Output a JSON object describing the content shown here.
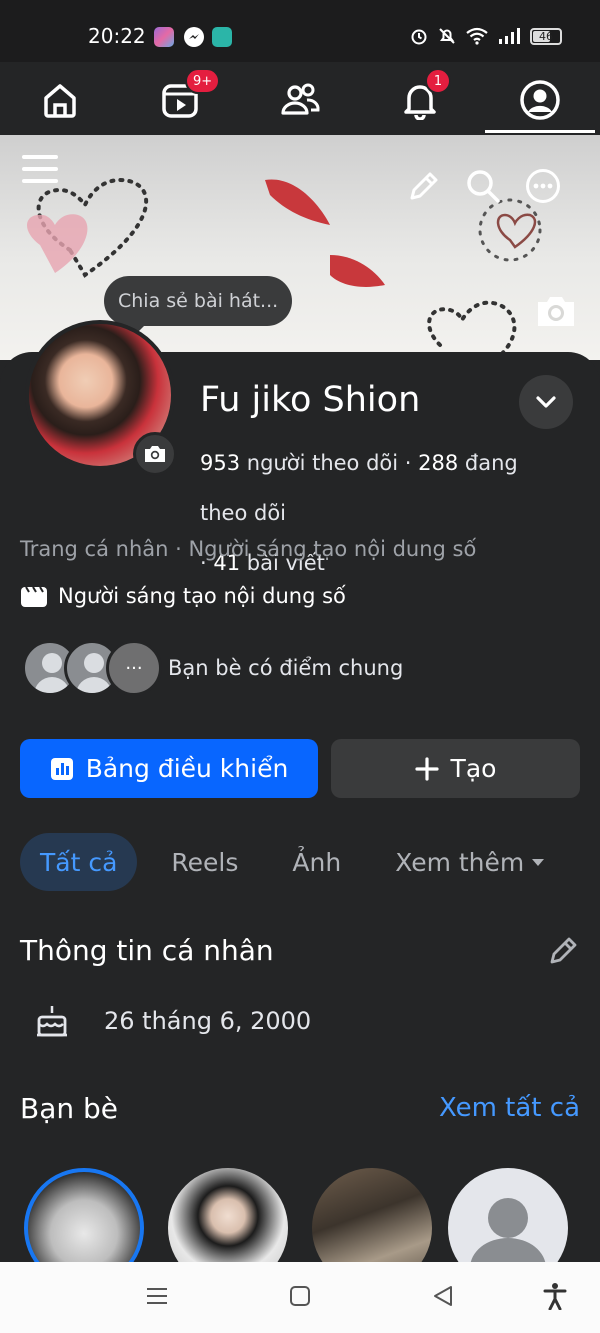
{
  "status_bar": {
    "time": "20:22",
    "battery": "46"
  },
  "nav": {
    "tabs": [
      {
        "name": "home",
        "icon": "home-icon"
      },
      {
        "name": "reels",
        "icon": "reels-icon",
        "badge": "9+"
      },
      {
        "name": "friends",
        "icon": "friends-icon"
      },
      {
        "name": "notifications",
        "icon": "bell-icon",
        "badge": "1"
      },
      {
        "name": "profile",
        "icon": "profile-icon",
        "active": true
      }
    ]
  },
  "cover": {
    "tooltip": "Chia sẻ bài hát..."
  },
  "profile": {
    "name": "Fu jiko Shion",
    "followers_count": "953",
    "followers_label": "người theo dõi",
    "following_count": "288",
    "following_label": "đang theo dõi",
    "posts_count": "41",
    "posts_label": "bài viết",
    "category_line": "Trang cá nhân · Người sáng tạo nội dung số",
    "creator_label": "Người sáng tạo nội dung số",
    "mutual_label": "Bạn bè có điểm chung"
  },
  "actions": {
    "dashboard": "Bảng điều khiển",
    "create": "Tạo"
  },
  "tabs": [
    "Tất cả",
    "Reels",
    "Ảnh",
    "Xem thêm"
  ],
  "about": {
    "title": "Thông tin cá nhân",
    "birthday": "26 tháng 6, 2000"
  },
  "friends": {
    "title": "Bạn bè",
    "see_all": "Xem tất cả"
  },
  "colors": {
    "accent": "#0866ff",
    "badge": "#e41e3f",
    "link": "#4599ff",
    "background": "#242526"
  }
}
